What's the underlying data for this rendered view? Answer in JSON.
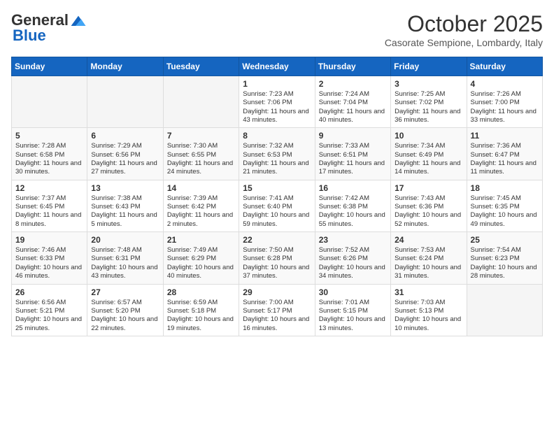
{
  "header": {
    "logo_general": "General",
    "logo_blue": "Blue",
    "month_title": "October 2025",
    "location": "Casorate Sempione, Lombardy, Italy"
  },
  "weekdays": [
    "Sunday",
    "Monday",
    "Tuesday",
    "Wednesday",
    "Thursday",
    "Friday",
    "Saturday"
  ],
  "weeks": [
    [
      {
        "day": "",
        "info": ""
      },
      {
        "day": "",
        "info": ""
      },
      {
        "day": "",
        "info": ""
      },
      {
        "day": "1",
        "info": "Sunrise: 7:23 AM\nSunset: 7:06 PM\nDaylight: 11 hours and 43 minutes."
      },
      {
        "day": "2",
        "info": "Sunrise: 7:24 AM\nSunset: 7:04 PM\nDaylight: 11 hours and 40 minutes."
      },
      {
        "day": "3",
        "info": "Sunrise: 7:25 AM\nSunset: 7:02 PM\nDaylight: 11 hours and 36 minutes."
      },
      {
        "day": "4",
        "info": "Sunrise: 7:26 AM\nSunset: 7:00 PM\nDaylight: 11 hours and 33 minutes."
      }
    ],
    [
      {
        "day": "5",
        "info": "Sunrise: 7:28 AM\nSunset: 6:58 PM\nDaylight: 11 hours and 30 minutes."
      },
      {
        "day": "6",
        "info": "Sunrise: 7:29 AM\nSunset: 6:56 PM\nDaylight: 11 hours and 27 minutes."
      },
      {
        "day": "7",
        "info": "Sunrise: 7:30 AM\nSunset: 6:55 PM\nDaylight: 11 hours and 24 minutes."
      },
      {
        "day": "8",
        "info": "Sunrise: 7:32 AM\nSunset: 6:53 PM\nDaylight: 11 hours and 21 minutes."
      },
      {
        "day": "9",
        "info": "Sunrise: 7:33 AM\nSunset: 6:51 PM\nDaylight: 11 hours and 17 minutes."
      },
      {
        "day": "10",
        "info": "Sunrise: 7:34 AM\nSunset: 6:49 PM\nDaylight: 11 hours and 14 minutes."
      },
      {
        "day": "11",
        "info": "Sunrise: 7:36 AM\nSunset: 6:47 PM\nDaylight: 11 hours and 11 minutes."
      }
    ],
    [
      {
        "day": "12",
        "info": "Sunrise: 7:37 AM\nSunset: 6:45 PM\nDaylight: 11 hours and 8 minutes."
      },
      {
        "day": "13",
        "info": "Sunrise: 7:38 AM\nSunset: 6:43 PM\nDaylight: 11 hours and 5 minutes."
      },
      {
        "day": "14",
        "info": "Sunrise: 7:39 AM\nSunset: 6:42 PM\nDaylight: 11 hours and 2 minutes."
      },
      {
        "day": "15",
        "info": "Sunrise: 7:41 AM\nSunset: 6:40 PM\nDaylight: 10 hours and 59 minutes."
      },
      {
        "day": "16",
        "info": "Sunrise: 7:42 AM\nSunset: 6:38 PM\nDaylight: 10 hours and 55 minutes."
      },
      {
        "day": "17",
        "info": "Sunrise: 7:43 AM\nSunset: 6:36 PM\nDaylight: 10 hours and 52 minutes."
      },
      {
        "day": "18",
        "info": "Sunrise: 7:45 AM\nSunset: 6:35 PM\nDaylight: 10 hours and 49 minutes."
      }
    ],
    [
      {
        "day": "19",
        "info": "Sunrise: 7:46 AM\nSunset: 6:33 PM\nDaylight: 10 hours and 46 minutes."
      },
      {
        "day": "20",
        "info": "Sunrise: 7:48 AM\nSunset: 6:31 PM\nDaylight: 10 hours and 43 minutes."
      },
      {
        "day": "21",
        "info": "Sunrise: 7:49 AM\nSunset: 6:29 PM\nDaylight: 10 hours and 40 minutes."
      },
      {
        "day": "22",
        "info": "Sunrise: 7:50 AM\nSunset: 6:28 PM\nDaylight: 10 hours and 37 minutes."
      },
      {
        "day": "23",
        "info": "Sunrise: 7:52 AM\nSunset: 6:26 PM\nDaylight: 10 hours and 34 minutes."
      },
      {
        "day": "24",
        "info": "Sunrise: 7:53 AM\nSunset: 6:24 PM\nDaylight: 10 hours and 31 minutes."
      },
      {
        "day": "25",
        "info": "Sunrise: 7:54 AM\nSunset: 6:23 PM\nDaylight: 10 hours and 28 minutes."
      }
    ],
    [
      {
        "day": "26",
        "info": "Sunrise: 6:56 AM\nSunset: 5:21 PM\nDaylight: 10 hours and 25 minutes."
      },
      {
        "day": "27",
        "info": "Sunrise: 6:57 AM\nSunset: 5:20 PM\nDaylight: 10 hours and 22 minutes."
      },
      {
        "day": "28",
        "info": "Sunrise: 6:59 AM\nSunset: 5:18 PM\nDaylight: 10 hours and 19 minutes."
      },
      {
        "day": "29",
        "info": "Sunrise: 7:00 AM\nSunset: 5:17 PM\nDaylight: 10 hours and 16 minutes."
      },
      {
        "day": "30",
        "info": "Sunrise: 7:01 AM\nSunset: 5:15 PM\nDaylight: 10 hours and 13 minutes."
      },
      {
        "day": "31",
        "info": "Sunrise: 7:03 AM\nSunset: 5:13 PM\nDaylight: 10 hours and 10 minutes."
      },
      {
        "day": "",
        "info": ""
      }
    ]
  ]
}
